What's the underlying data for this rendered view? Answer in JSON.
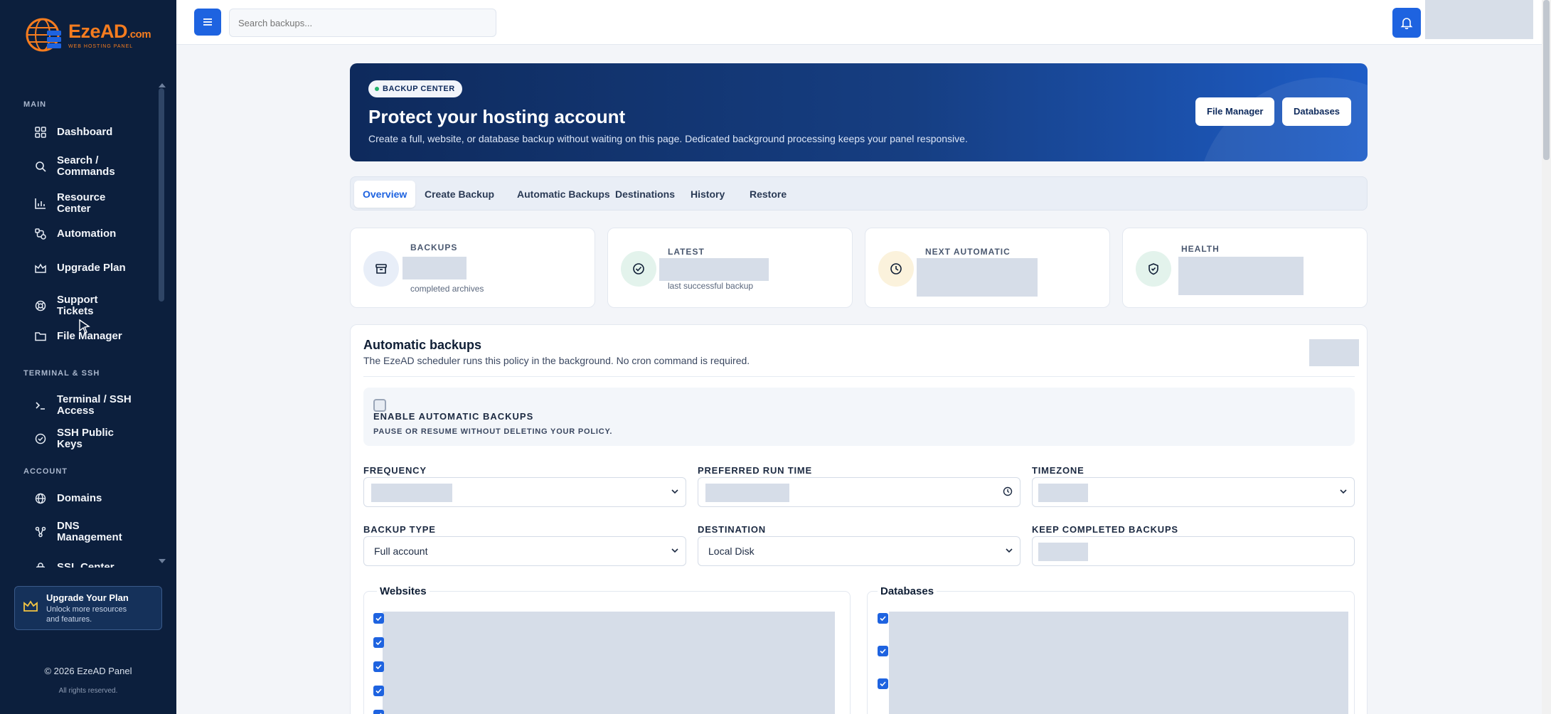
{
  "brand": {
    "name": "EzeAD",
    "suffix": ".com",
    "tagline": "WEB HOSTING PANEL"
  },
  "sidebar": {
    "sections": {
      "main": "MAIN",
      "terminal": "TERMINAL & SSH",
      "account": "ACCOUNT"
    },
    "items": [
      {
        "label": "Dashboard",
        "icon": "grid-icon"
      },
      {
        "label": "Search / Commands",
        "icon": "search-icon"
      },
      {
        "label": "Resource Center",
        "icon": "bar-chart-icon"
      },
      {
        "label": "Automation",
        "icon": "workflow-icon"
      },
      {
        "label": "Upgrade Plan",
        "icon": "upgrade-icon"
      },
      {
        "label": "Support Tickets",
        "icon": "lifebuoy-icon"
      },
      {
        "label": "File Manager",
        "icon": "folder-icon"
      },
      {
        "label": "Terminal / SSH Access",
        "icon": "terminal-icon"
      },
      {
        "label": "SSH Public Keys",
        "icon": "key-check-icon"
      },
      {
        "label": "Domains",
        "icon": "globe-icon"
      },
      {
        "label": "DNS Management",
        "icon": "network-icon"
      },
      {
        "label": "SSL Center",
        "icon": "lock-icon"
      }
    ],
    "upgrade": {
      "title": "Upgrade Your Plan",
      "subtitle": "Unlock more resources and features."
    },
    "copyright": "© 2026 EzeAD Panel",
    "rights": "All rights reserved."
  },
  "topbar": {
    "search_placeholder": "Search backups..."
  },
  "hero": {
    "badge": "BACKUP CENTER",
    "title": "Protect your hosting account",
    "subtitle": "Create a full, website, or database backup without waiting on this page. Dedicated background processing keeps your panel responsive.",
    "buttons": {
      "file_manager": "File Manager",
      "databases": "Databases"
    }
  },
  "tabs": [
    "Overview",
    "Create Backup",
    "Automatic Backups",
    "Destinations",
    "History",
    "Restore"
  ],
  "active_tab": "Overview",
  "stats": {
    "backups": {
      "label": "BACKUPS",
      "sub": "completed archives"
    },
    "latest": {
      "label": "LATEST",
      "sub": "last successful backup"
    },
    "next": {
      "label": "NEXT AUTOMATIC"
    },
    "health": {
      "label": "HEALTH"
    }
  },
  "auto": {
    "title": "Automatic backups",
    "subtitle": "The EzeAD scheduler runs this policy in the background. No cron command is required.",
    "toggle_title": "ENABLE AUTOMATIC BACKUPS",
    "toggle_sub": "PAUSE OR RESUME WITHOUT DELETING YOUR POLICY.",
    "labels": {
      "frequency": "FREQUENCY",
      "run_time": "PREFERRED RUN TIME",
      "timezone": "TIMEZONE",
      "backup_type": "BACKUP TYPE",
      "destination": "DESTINATION",
      "keep": "KEEP COMPLETED BACKUPS"
    },
    "values": {
      "backup_type": "Full account",
      "destination": "Local Disk"
    },
    "websites_title": "Websites",
    "databases_title": "Databases"
  },
  "colors": {
    "sidebar": "#0c1f3d",
    "accent": "#1e63e0",
    "hero_start": "#0e2a5c",
    "brand_orange": "#f57c1f"
  }
}
